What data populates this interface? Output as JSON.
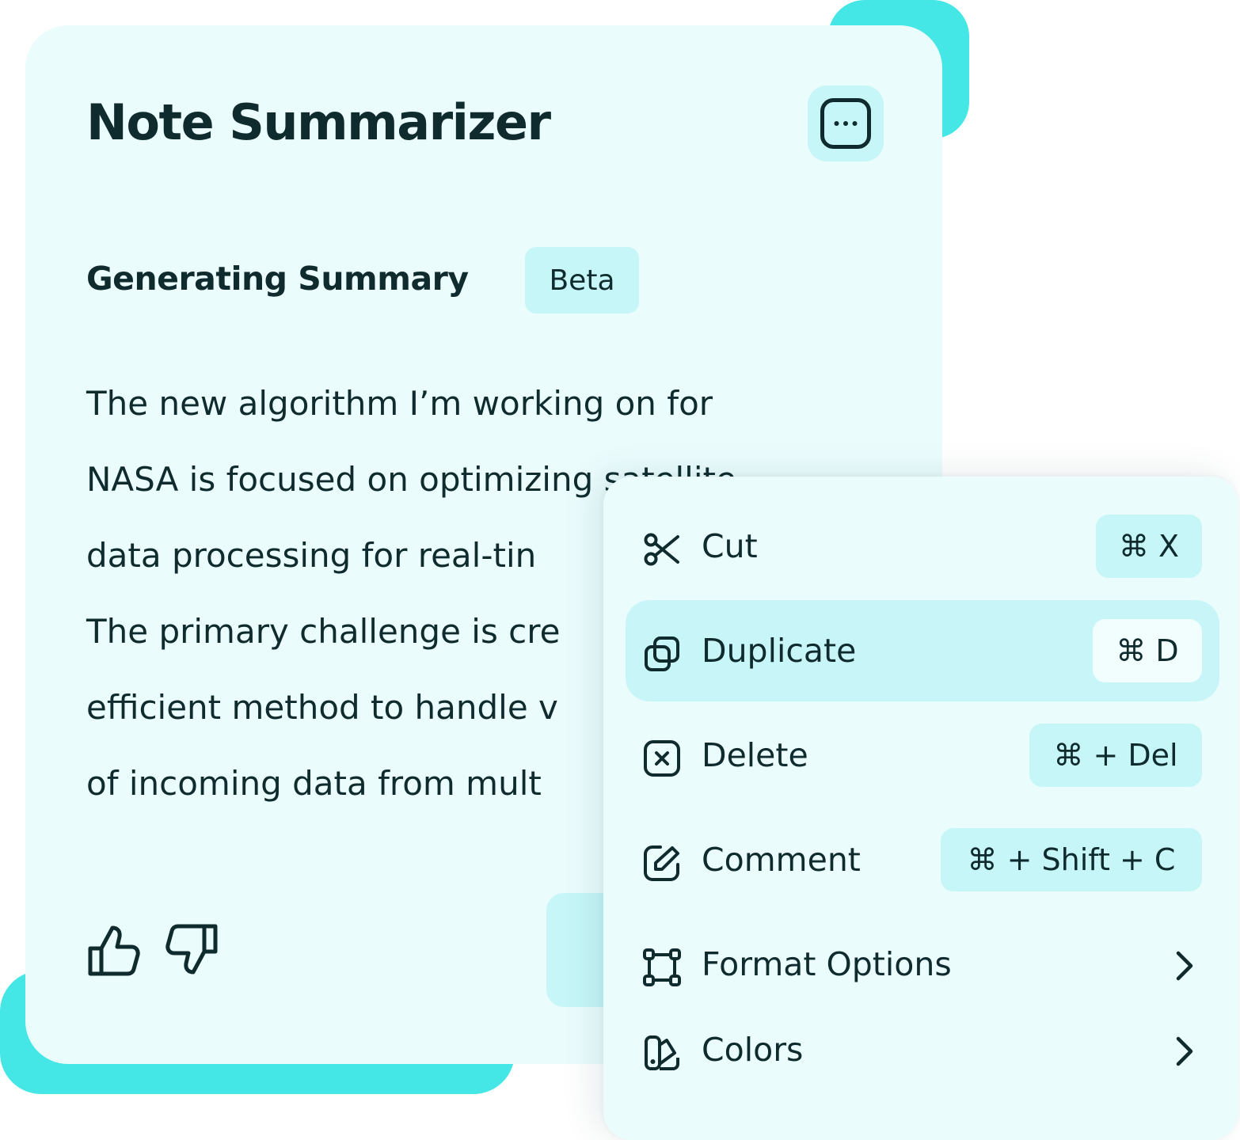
{
  "card": {
    "title": "Note Summarizer",
    "more_icon": "more-horizontal-icon",
    "subtitle": "Generating Summary",
    "badge": "Beta",
    "summary_lines": [
      "The new algorithm I’m working on for",
      "NASA is focused on optimizing satellite",
      "data processing for real-tin",
      "The primary challenge is cre",
      "efficient method to handle v",
      "of incoming data from mult"
    ],
    "feedback_icons": [
      "thumbs-up-icon",
      "thumbs-down-icon"
    ]
  },
  "menu": {
    "items": [
      {
        "icon": "scissors-icon",
        "label": "Cut",
        "shortcut": "⌘ X"
      },
      {
        "icon": "duplicate-icon",
        "label": "Duplicate",
        "shortcut": "⌘ D",
        "active": true
      },
      {
        "icon": "delete-x-icon",
        "label": "Delete",
        "shortcut": "⌘ + Del"
      },
      {
        "icon": "edit-icon",
        "label": "Comment",
        "shortcut": "⌘ + Shift + C"
      },
      {
        "icon": "format-frame-icon",
        "label": "Format Options",
        "submenu": true
      },
      {
        "icon": "palette-icon",
        "label": "Colors",
        "submenu": true
      }
    ]
  },
  "colors": {
    "card_bg": "#ebfcfd",
    "accent": "#44e6e6",
    "chip": "#c6f6f8",
    "text": "#0f2b2e"
  }
}
